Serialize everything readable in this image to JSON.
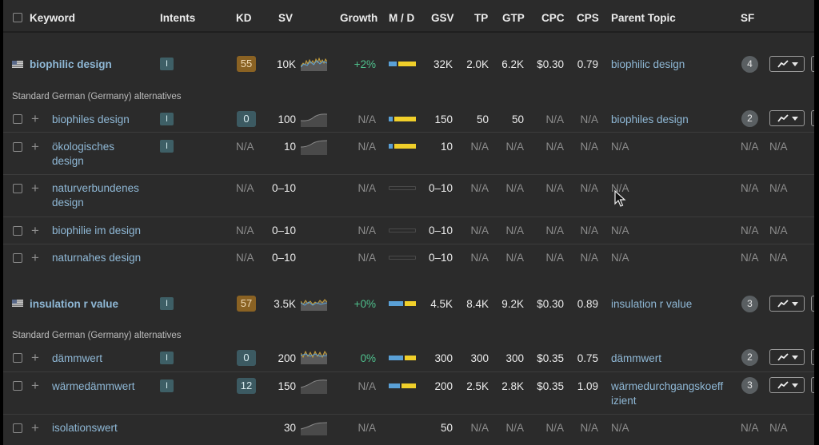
{
  "header": {
    "keyword": "Keyword",
    "intents": "Intents",
    "kd": "KD",
    "sv": "SV",
    "growth": "Growth",
    "md": "M / D",
    "gsv": "GSV",
    "tp": "TP",
    "gtp": "GTP",
    "cpc": "CPC",
    "cps": "CPS",
    "parent": "Parent Topic",
    "sf": "SF"
  },
  "alt_label": "Standard German (Germany) alternatives",
  "rows": [
    {
      "kw": "biophilic design",
      "intent": "I",
      "kd": "55",
      "sv": "10K",
      "growth": "+2%",
      "gsv": "32K",
      "tp": "2.0K",
      "gtp": "6.2K",
      "cpc": "$0.30",
      "cps": "0.79",
      "parent": "biophilic design",
      "sf": "4"
    },
    {
      "kw": "biophiles design",
      "intent": "I",
      "kd": "0",
      "sv": "100",
      "growth": "N/A",
      "gsv": "150",
      "tp": "50",
      "gtp": "50",
      "cpc": "N/A",
      "cps": "N/A",
      "parent": "biophiles design",
      "sf": "2"
    },
    {
      "kw1": "ökologisches",
      "kw2": "design",
      "intent": "I",
      "kd": "N/A",
      "sv": "10",
      "growth": "N/A",
      "gsv": "10",
      "tp": "N/A",
      "gtp": "N/A",
      "cpc": "N/A",
      "cps": "N/A",
      "parent": "N/A",
      "sf": "N/A",
      "extra": "N/A"
    },
    {
      "kw1": "naturverbundenes",
      "kw2": "design",
      "kd": "N/A",
      "sv": "0–10",
      "growth": "N/A",
      "gsv": "0–10",
      "tp": "N/A",
      "gtp": "N/A",
      "cpc": "N/A",
      "cps": "N/A",
      "parent": "N/A",
      "sf": "N/A",
      "extra": "N/A"
    },
    {
      "kw": "biophilie im design",
      "kd": "N/A",
      "sv": "0–10",
      "growth": "N/A",
      "gsv": "0–10",
      "tp": "N/A",
      "gtp": "N/A",
      "cpc": "N/A",
      "cps": "N/A",
      "parent": "N/A",
      "sf": "N/A",
      "extra": "N/A"
    },
    {
      "kw": "naturnahes design",
      "kd": "N/A",
      "sv": "0–10",
      "growth": "N/A",
      "gsv": "0–10",
      "tp": "N/A",
      "gtp": "N/A",
      "cpc": "N/A",
      "cps": "N/A",
      "parent": "N/A",
      "sf": "N/A",
      "extra": "N/A"
    },
    {
      "kw": "insulation r value",
      "intent": "I",
      "kd": "57",
      "sv": "3.5K",
      "growth": "+0%",
      "gsv": "4.5K",
      "tp": "8.4K",
      "gtp": "9.2K",
      "cpc": "$0.30",
      "cps": "0.89",
      "parent": "insulation r value",
      "sf": "3"
    },
    {
      "kw": "dämmwert",
      "intent": "I",
      "kd": "0",
      "sv": "200",
      "growth": "0%",
      "gsv": "300",
      "tp": "300",
      "gtp": "300",
      "cpc": "$0.35",
      "cps": "0.75",
      "parent": "dämmwert",
      "sf": "2"
    },
    {
      "kw": "wärmedämmwert",
      "intent": "I",
      "kd": "12",
      "sv": "150",
      "growth": "N/A",
      "gsv": "200",
      "tp": "2.5K",
      "gtp": "2.8K",
      "cpc": "$0.35",
      "cps": "1.09",
      "parent1": "wärmedurchgangskoeff",
      "parent2": "izient",
      "sf": "3"
    },
    {
      "kw": "isolationswert",
      "sv": "30",
      "gsv": "50",
      "growth": "N/A",
      "tp": "N/A",
      "gtp": "N/A",
      "cpc": "N/A",
      "cps": "N/A",
      "parent": "N/A",
      "sf": "N/A",
      "extra": "N/A"
    }
  ],
  "colors": {
    "link": "#8fb8d6",
    "kd_hard": "#8a6223",
    "kd_easy": "#3c5a62",
    "growth": "#4fc08d"
  },
  "icons": {
    "trend": "trend-chart-icon",
    "flag": "us-flag-icon",
    "add": "plus-icon",
    "cursor": "mouse-pointer-icon"
  }
}
